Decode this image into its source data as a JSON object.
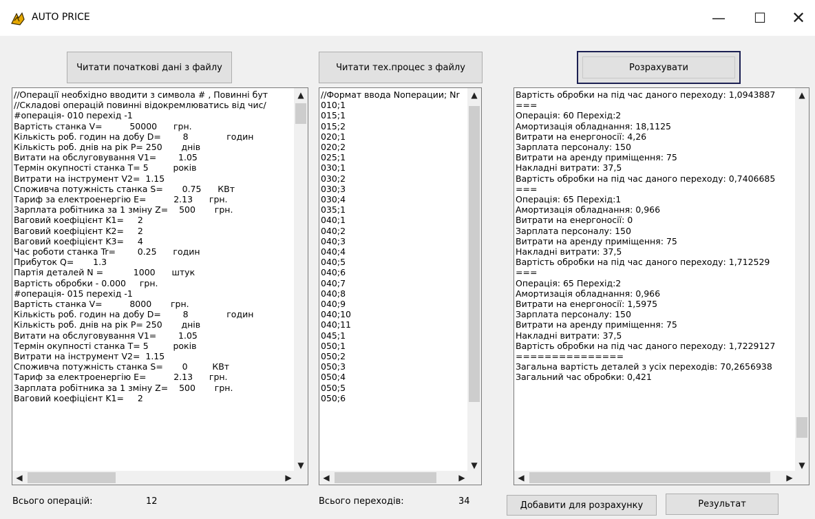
{
  "window": {
    "title": "AUTO PRICE",
    "icon": "app-icon",
    "controls": {
      "minimize": "—",
      "maximize": "☐",
      "close": "✕"
    }
  },
  "buttons": {
    "read_initial": "Читати початкові дані з файлу",
    "read_process": "Читати тех.процес з файлу",
    "calculate": "Розрахувати",
    "add_for_calc": "Добавити для розрахунку",
    "result": "Результат"
  },
  "memo_initial": {
    "lines": [
      "//Операції необхідно вводити з символа # , Повинні бут",
      "//Складові операцій повинні відокремлюватись від чис/",
      "#операція- 010 перехід -1",
      "Вартість станка V=          50000      грн.",
      "Кількість роб. годин на добу D=        8              годин",
      "Кількість роб. днів на рік P= 250       днів",
      "Витати на обслуговування V1=        1.05",
      "Термін окупності станка T= 5         років",
      "Витрати на інструмент V2=  1.15",
      "Споживча потужність станка S=       0.75      КВт",
      "Тариф за електроенергію E=          2.13      грн.",
      "Зарплата робітника за 1 зміну Z=    500       грн.",
      "Ваговий коефіцієнт K1=     2",
      "Ваговий коефіцієнт K2=     2",
      "Ваговий коефіцієнт K3=     4",
      "Час роботи станка Tr=        0.25      годин",
      "Прибуток Q=       1.3",
      "Партія деталей N =           1000      штук",
      "Вартість обробки - 0.000     грн.",
      "#операція- 015 перехід -1",
      "Вартість станка V=          8000       грн.",
      "Кількість роб. годин на добу D=        8              годин",
      "Кількість роб. днів на рік P= 250       днів",
      "Витати на обслуговування V1=        1.05",
      "Термін окупності станка T= 5         років",
      "Витрати на інструмент V2=  1.15",
      "Споживча потужність станка S=       0         КВт",
      "Тариф за електроенергію E=          2.13      грн.",
      "Зарплата робітника за 1 зміну Z=    500       грн.",
      "Ваговий коефіцієнт K1=     2"
    ]
  },
  "memo_process": {
    "lines": [
      "//Формат ввода Nоперации; Nr",
      "010;1",
      "015;1",
      "015;2",
      "020;1",
      "020;2",
      "025;1",
      "030;1",
      "030;2",
      "030;3",
      "030;4",
      "035;1",
      "040;1",
      "040;2",
      "040;3",
      "040;4",
      "040;5",
      "040;6",
      "040;7",
      "040;8",
      "040;9",
      "040;10",
      "040;11",
      "045;1",
      "050;1",
      "050;2",
      "050;3",
      "050;4",
      "050;5",
      "050;6"
    ]
  },
  "memo_result": {
    "lines": [
      "Вартість обробки на під час даного переходу: 1,0943887",
      "===",
      "Операція: 60 Перехід:2",
      "Амортизація обладнання: 18,1125",
      "Витрати на енергоносії: 4,26",
      "Зарплата персоналу: 150",
      "Витрати на аренду приміщення: 75",
      "Накладні витрати: 37,5",
      "Вартість обробки на під час даного переходу: 0,7406685",
      "===",
      "Операція: 65 Перехід:1",
      "Амортизація обладнання: 0,966",
      "Витрати на енергоносії: 0",
      "Зарплата персоналу: 150",
      "Витрати на аренду приміщення: 75",
      "Накладні витрати: 37,5",
      "Вартість обробки на під час даного переходу: 1,712529",
      "===",
      "Операція: 65 Перехід:2",
      "Амортизація обладнання: 0,966",
      "Витрати на енергоносії: 1,5975",
      "Зарплата персоналу: 150",
      "Витрати на аренду приміщення: 75",
      "Накладні витрати: 37,5",
      "Вартість обробки на під час даного переходу: 1,7229127",
      "===============",
      "Загальна вартість деталей з усіх переходів: 70,2656938",
      "Загальний час обробки: 0,421"
    ]
  },
  "status": {
    "ops_label": "Всього операцій:",
    "ops_value": "12",
    "transitions_label": "Всього переходів:",
    "transitions_value": "34"
  },
  "scroll_arrows": {
    "up": "▲",
    "down": "▼",
    "left": "◀",
    "right": "▶"
  }
}
